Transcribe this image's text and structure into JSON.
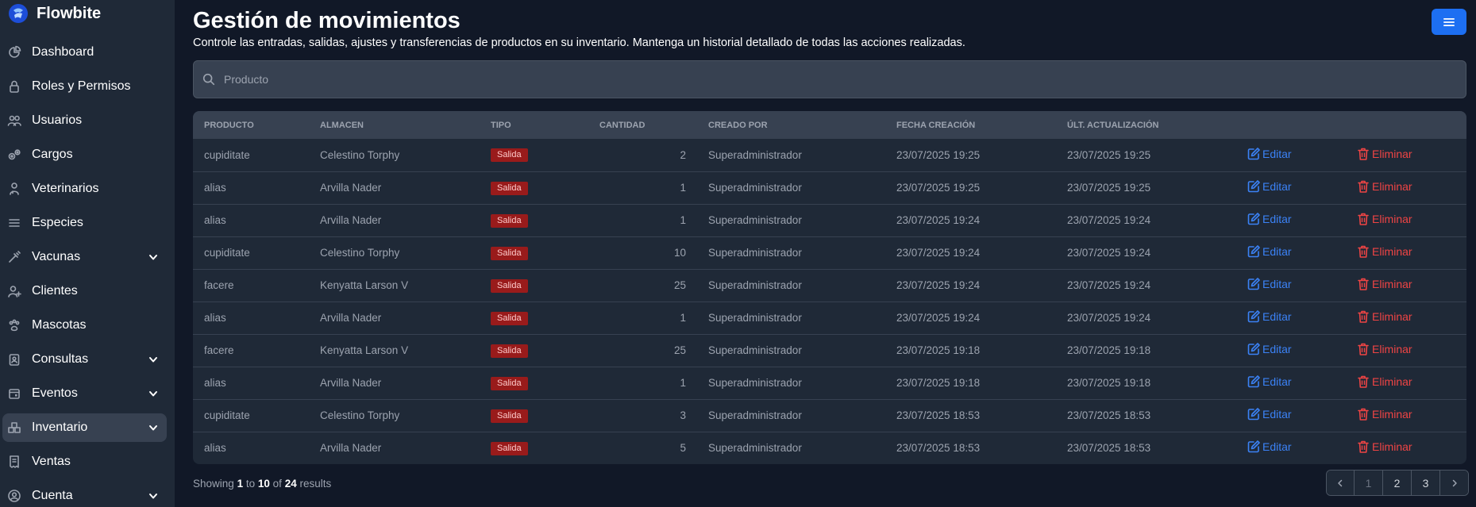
{
  "brand": {
    "name": "Flowbite"
  },
  "sidebar": {
    "items": [
      {
        "label": "Dashboard",
        "icon": "dashboard-icon",
        "chevron": false
      },
      {
        "label": "Roles y Permisos",
        "icon": "lock-icon",
        "chevron": false
      },
      {
        "label": "Usuarios",
        "icon": "users-icon",
        "chevron": false
      },
      {
        "label": "Cargos",
        "icon": "cogs-icon",
        "chevron": false
      },
      {
        "label": "Veterinarios",
        "icon": "doctor-icon",
        "chevron": false
      },
      {
        "label": "Especies",
        "icon": "list-icon",
        "chevron": false
      },
      {
        "label": "Vacunas",
        "icon": "syringe-icon",
        "chevron": true
      },
      {
        "label": "Clientes",
        "icon": "user-add-icon",
        "chevron": false
      },
      {
        "label": "Mascotas",
        "icon": "paw-icon",
        "chevron": false
      },
      {
        "label": "Consultas",
        "icon": "clipboard-icon",
        "chevron": true
      },
      {
        "label": "Eventos",
        "icon": "calendar-icon",
        "chevron": true
      },
      {
        "label": "Inventario",
        "icon": "warehouse-icon",
        "chevron": true,
        "active": true
      },
      {
        "label": "Ventas",
        "icon": "receipt-icon",
        "chevron": false
      },
      {
        "label": "Cuenta",
        "icon": "account-icon",
        "chevron": true
      }
    ]
  },
  "header": {
    "title": "Gestión de movimientos",
    "subtitle": "Controle las entradas, salidas, ajustes y transferencias de productos en su inventario. Mantenga un historial detallado de todas las acciones realizadas.",
    "menu_icon": "hamburger-icon"
  },
  "search": {
    "placeholder": "Producto",
    "value": ""
  },
  "table": {
    "headers": [
      "PRODUCTO",
      "ALMACEN",
      "TIPO",
      "CANTIDAD",
      "CREADO POR",
      "FECHA CREACIÓN",
      "ÚLT. ACTUALIZACIÓN",
      "",
      ""
    ],
    "edit_label": "Editar",
    "delete_label": "Eliminar",
    "rows": [
      {
        "producto": "cupiditate",
        "almacen": "Celestino Torphy",
        "tipo": "Salida",
        "cantidad": "2",
        "creado_por": "Superadministrador",
        "fecha_creacion": "23/07/2025 19:25",
        "ult_actualizacion": "23/07/2025 19:25"
      },
      {
        "producto": "alias",
        "almacen": "Arvilla Nader",
        "tipo": "Salida",
        "cantidad": "1",
        "creado_por": "Superadministrador",
        "fecha_creacion": "23/07/2025 19:25",
        "ult_actualizacion": "23/07/2025 19:25"
      },
      {
        "producto": "alias",
        "almacen": "Arvilla Nader",
        "tipo": "Salida",
        "cantidad": "1",
        "creado_por": "Superadministrador",
        "fecha_creacion": "23/07/2025 19:24",
        "ult_actualizacion": "23/07/2025 19:24"
      },
      {
        "producto": "cupiditate",
        "almacen": "Celestino Torphy",
        "tipo": "Salida",
        "cantidad": "10",
        "creado_por": "Superadministrador",
        "fecha_creacion": "23/07/2025 19:24",
        "ult_actualizacion": "23/07/2025 19:24"
      },
      {
        "producto": "facere",
        "almacen": "Kenyatta Larson V",
        "tipo": "Salida",
        "cantidad": "25",
        "creado_por": "Superadministrador",
        "fecha_creacion": "23/07/2025 19:24",
        "ult_actualizacion": "23/07/2025 19:24"
      },
      {
        "producto": "alias",
        "almacen": "Arvilla Nader",
        "tipo": "Salida",
        "cantidad": "1",
        "creado_por": "Superadministrador",
        "fecha_creacion": "23/07/2025 19:24",
        "ult_actualizacion": "23/07/2025 19:24"
      },
      {
        "producto": "facere",
        "almacen": "Kenyatta Larson V",
        "tipo": "Salida",
        "cantidad": "25",
        "creado_por": "Superadministrador",
        "fecha_creacion": "23/07/2025 19:18",
        "ult_actualizacion": "23/07/2025 19:18"
      },
      {
        "producto": "alias",
        "almacen": "Arvilla Nader",
        "tipo": "Salida",
        "cantidad": "1",
        "creado_por": "Superadministrador",
        "fecha_creacion": "23/07/2025 19:18",
        "ult_actualizacion": "23/07/2025 19:18"
      },
      {
        "producto": "cupiditate",
        "almacen": "Celestino Torphy",
        "tipo": "Salida",
        "cantidad": "3",
        "creado_por": "Superadministrador",
        "fecha_creacion": "23/07/2025 18:53",
        "ult_actualizacion": "23/07/2025 18:53"
      },
      {
        "producto": "alias",
        "almacen": "Arvilla Nader",
        "tipo": "Salida",
        "cantidad": "5",
        "creado_por": "Superadministrador",
        "fecha_creacion": "23/07/2025 18:53",
        "ult_actualizacion": "23/07/2025 18:53"
      }
    ]
  },
  "footer": {
    "showing": "Showing",
    "from": "1",
    "to_word": "to",
    "to": "10",
    "of_word": "of",
    "total": "24",
    "results": "results"
  },
  "pagination": {
    "prev_icon": "chevron-left-icon",
    "next_icon": "chevron-right-icon",
    "pages": [
      "1",
      "2",
      "3"
    ],
    "current": "1"
  },
  "colors": {
    "background": "#111827",
    "sidebar": "#1f2937",
    "accent": "#1d6ff2",
    "edit": "#3b82f6",
    "delete": "#ef4444",
    "badge": "#991b1b"
  }
}
